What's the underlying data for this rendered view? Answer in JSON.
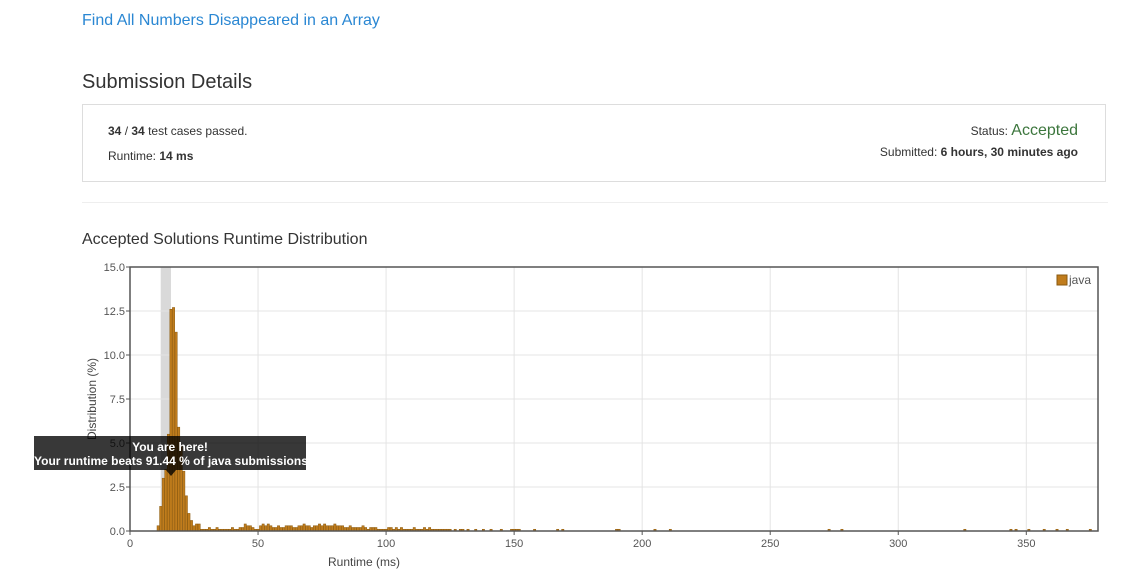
{
  "problem": {
    "title": "Find All Numbers Disappeared in an Array"
  },
  "page": {
    "heading": "Submission Details"
  },
  "details": {
    "cases_passed": "34",
    "cases_sep": " / ",
    "cases_total": "34",
    "cases_suffix": " test cases passed.",
    "runtime_label": "Runtime: ",
    "runtime_value": "14 ms",
    "status_label": "Status: ",
    "status_value": "Accepted",
    "submitted_label": "Submitted: ",
    "submitted_value": "6 hours, 30 minutes ago"
  },
  "distribution": {
    "title": "Accepted Solutions Runtime Distribution"
  },
  "tooltip": {
    "line1": "You are here!",
    "line2": "Your runtime beats 91.44 % of java submissions."
  },
  "colors": {
    "link": "#2a87d3",
    "accepted": "#3c763d",
    "bar": "#c07c1c",
    "bar_stroke": "#8a5a10",
    "highlight": "#d9d9d9"
  },
  "chart_data": {
    "type": "bar",
    "xlabel": "Runtime (ms)",
    "ylabel": "Distribution (%)",
    "xlim": [
      0,
      378
    ],
    "ylim": [
      0,
      15
    ],
    "xticks": [
      0,
      50,
      100,
      150,
      200,
      250,
      300,
      350
    ],
    "yticks": [
      "0.0",
      "2.5",
      "5.0",
      "7.5",
      "10.0",
      "12.5",
      "15.0"
    ],
    "legend": {
      "label": "java",
      "position": "top-right"
    },
    "highlight_range": [
      12,
      16
    ],
    "series": [
      {
        "name": "java",
        "x": [
          11,
          12,
          13,
          14,
          15,
          16,
          17,
          18,
          19,
          20,
          21,
          22,
          23,
          24,
          25,
          26,
          27,
          28,
          29,
          30,
          31,
          32,
          33,
          34,
          35,
          36,
          37,
          38,
          39,
          40,
          41,
          42,
          43,
          44,
          45,
          46,
          47,
          48,
          49,
          50,
          51,
          52,
          53,
          54,
          55,
          56,
          57,
          58,
          59,
          60,
          61,
          62,
          63,
          64,
          65,
          66,
          67,
          68,
          69,
          70,
          71,
          72,
          73,
          74,
          75,
          76,
          77,
          78,
          79,
          80,
          81,
          82,
          83,
          84,
          85,
          86,
          87,
          88,
          89,
          90,
          91,
          92,
          93,
          94,
          95,
          96,
          97,
          98,
          99,
          100,
          101,
          102,
          103,
          104,
          105,
          106,
          107,
          108,
          109,
          110,
          111,
          112,
          113,
          114,
          115,
          116,
          117,
          118,
          119,
          120,
          121,
          122,
          123,
          124,
          125,
          127,
          129,
          130,
          132,
          135,
          138,
          141,
          145,
          149,
          150,
          151,
          152,
          158,
          167,
          169,
          190,
          191,
          205,
          211,
          273,
          278,
          326,
          344,
          346,
          351,
          357,
          362,
          366,
          375
        ],
        "values": [
          0.3,
          1.4,
          3.0,
          3.5,
          5.5,
          12.6,
          12.7,
          11.3,
          5.9,
          4.8,
          3.4,
          2.0,
          1.0,
          0.6,
          0.3,
          0.4,
          0.4,
          0.1,
          0.1,
          0.1,
          0.2,
          0.1,
          0.1,
          0.2,
          0.1,
          0.1,
          0.1,
          0.1,
          0.1,
          0.2,
          0.1,
          0.1,
          0.2,
          0.2,
          0.4,
          0.3,
          0.3,
          0.2,
          0.1,
          0.1,
          0.3,
          0.4,
          0.3,
          0.4,
          0.3,
          0.2,
          0.2,
          0.3,
          0.2,
          0.2,
          0.3,
          0.3,
          0.3,
          0.2,
          0.2,
          0.3,
          0.3,
          0.4,
          0.3,
          0.3,
          0.2,
          0.3,
          0.3,
          0.4,
          0.3,
          0.4,
          0.3,
          0.3,
          0.3,
          0.4,
          0.3,
          0.3,
          0.3,
          0.2,
          0.2,
          0.3,
          0.2,
          0.2,
          0.2,
          0.2,
          0.3,
          0.2,
          0.1,
          0.2,
          0.2,
          0.2,
          0.1,
          0.1,
          0.1,
          0.1,
          0.2,
          0.2,
          0.1,
          0.2,
          0.1,
          0.2,
          0.1,
          0.1,
          0.1,
          0.1,
          0.2,
          0.1,
          0.1,
          0.1,
          0.2,
          0.1,
          0.2,
          0.1,
          0.1,
          0.1,
          0.1,
          0.1,
          0.1,
          0.1,
          0.1,
          0.1,
          0.1,
          0.1,
          0.1,
          0.1,
          0.1,
          0.1,
          0.1,
          0.1,
          0.1,
          0.1,
          0.1,
          0.1,
          0.1,
          0.1,
          0.1,
          0.1,
          0.1,
          0.1,
          0.1,
          0.1,
          0.1,
          0.1,
          0.1,
          0.1,
          0.1,
          0.1,
          0.1,
          0.1
        ]
      }
    ]
  }
}
